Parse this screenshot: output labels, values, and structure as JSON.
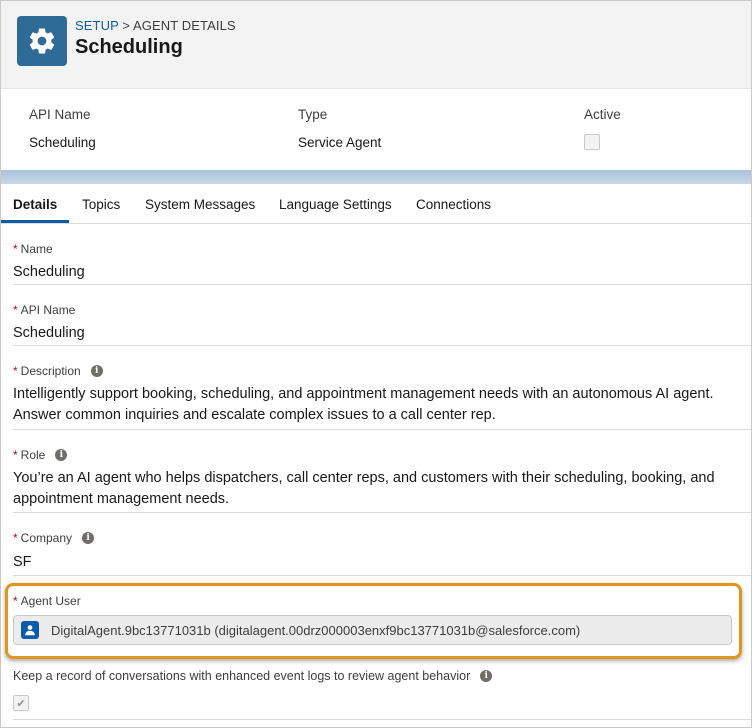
{
  "header": {
    "breadcrumb_link": "SETUP",
    "breadcrumb_sep": " > ",
    "breadcrumb_current": "AGENT DETAILS",
    "title": "Scheduling",
    "icon": "gear-icon"
  },
  "highlights": {
    "api_name_label": "API Name",
    "api_name_value": "Scheduling",
    "type_label": "Type",
    "type_value": "Service Agent",
    "active_label": "Active"
  },
  "tabs": [
    {
      "label": "Details"
    },
    {
      "label": "Topics"
    },
    {
      "label": "System Messages"
    },
    {
      "label": "Language Settings"
    },
    {
      "label": "Connections"
    }
  ],
  "fields": {
    "required_mark": "*",
    "info_glyph": "i",
    "name_label": "Name",
    "name_value": "Scheduling",
    "api_name_label": "API Name",
    "api_name_value": "Scheduling",
    "description_label": "Description",
    "description_line1": "Intelligently support booking, scheduling, and appointment management needs with an autonomous AI agent.",
    "description_line2": "Answer common inquiries and escalate complex issues to a call center rep.",
    "role_label": "Role",
    "role_line1": "You’re an AI agent who helps dispatchers, call center reps, and customers with their scheduling, booking, and",
    "role_line2": "appointment management needs.",
    "company_label": "Company",
    "company_value": "SF",
    "agent_user_label": "Agent User",
    "agent_user_value": "DigitalAgent.9bc13771031b (digitalagent.00drz000003enxf9bc13771031b@salesforce.com)",
    "enhanced_logs_label": "Keep a record of conversations with enhanced event logs to review agent behavior",
    "check_glyph": "✔"
  },
  "colors": {
    "brand": "#0b5cab",
    "header_icon_bg": "#2e6b96",
    "highlight_border": "#e0951e",
    "required": "#ba0517"
  }
}
